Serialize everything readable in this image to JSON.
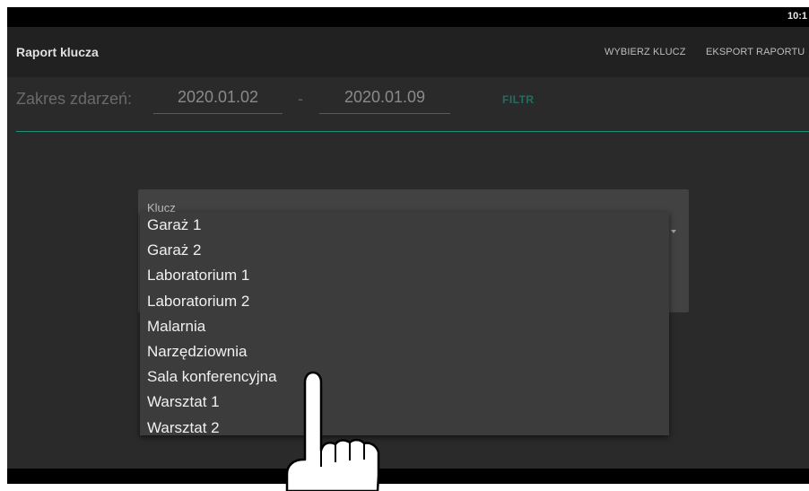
{
  "status_bar": {
    "time": "10:1"
  },
  "app_bar": {
    "title": "Raport klucza",
    "actions": [
      "WYBIERZ KLUCZ",
      "EKSPORT RAPORTU"
    ]
  },
  "filter": {
    "label": "Zakres zdarzeń:",
    "date_from": "2020.01.02",
    "separator": "-",
    "date_to": "2020.01.09",
    "button_label": "FILTR"
  },
  "dialog": {
    "field_label": "Klucz",
    "dropdown_icon": "arrow-drop-down-icon",
    "options": [
      "Garaż 1",
      "Garaż 2",
      "Laboratorium 1",
      "Laboratorium 2",
      "Malarnia",
      "Narzędziownia",
      "Sala konferencyjna",
      "Warsztat 1",
      "Warsztat 2"
    ]
  },
  "overlay": {
    "pointer_icon": "hand-pointer-icon"
  },
  "colors": {
    "background": "#000000",
    "app_bar": "#212121",
    "content": "#2a2a2a",
    "accent_teal": "#1f8c7c",
    "dialog": "#424242",
    "dropdown": "#3c3c3c"
  }
}
